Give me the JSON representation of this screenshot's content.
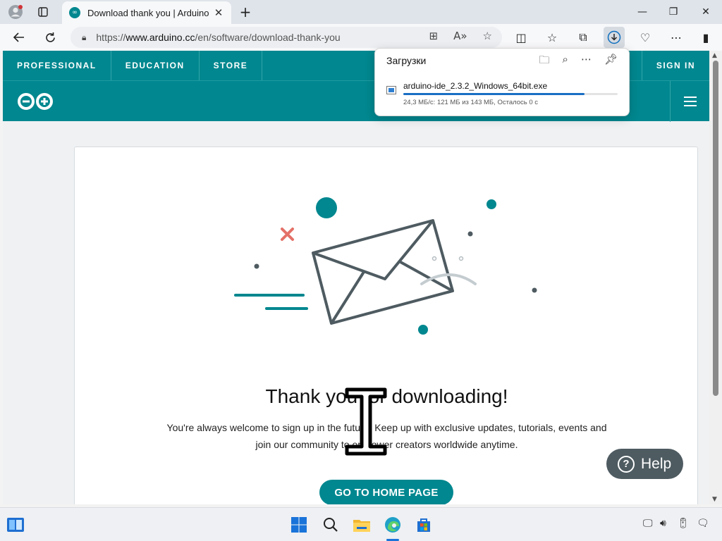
{
  "browser": {
    "tab_title": "Download thank you | Arduino",
    "url_prefix": "https://",
    "url_domain": "www.arduino.cc",
    "url_path": "/en/software/download-thank-you"
  },
  "site": {
    "nav": [
      "PROFESSIONAL",
      "EDUCATION",
      "STORE"
    ],
    "sign_in": "SIGN IN"
  },
  "content": {
    "heading": "Thank you for downloading!",
    "subtext": "You're always welcome to sign up in the future. Keep up with exclusive updates, tutorials, events and join our community to empower creators worldwide anytime.",
    "button": "GO TO HOME PAGE",
    "help": "Help"
  },
  "downloads": {
    "title": "Загрузки",
    "file_name": "arduino-ide_2.3.2_Windows_64bit.exe",
    "status": "24,3 МБ/с: 121 МБ из 143 МБ, Осталось 0 с",
    "progress": 0.846
  },
  "colors": {
    "brand": "#00878f",
    "accent_red": "#e47067",
    "dark": "#4e5b61"
  }
}
